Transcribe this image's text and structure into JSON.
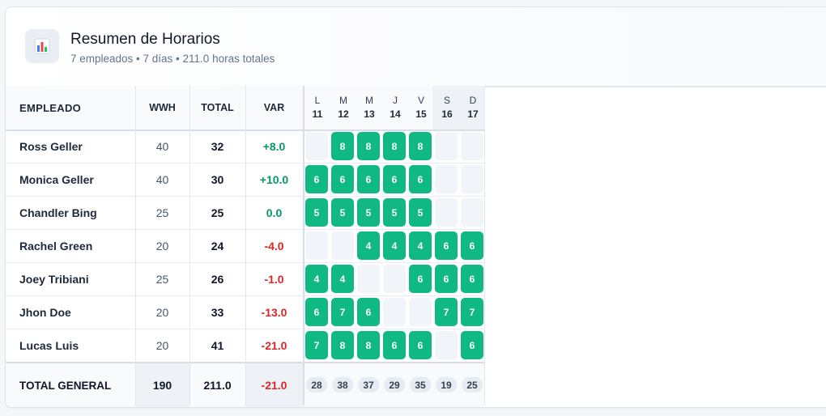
{
  "header": {
    "title": "Resumen de Horarios",
    "subtitle": "7 empleados • 7 días • 211.0 horas totales",
    "icon": "bar-chart-icon"
  },
  "columns": {
    "employee": "EMPLEADO",
    "wwh": "WWH",
    "total": "TOTAL",
    "var": "VAR"
  },
  "days": [
    {
      "letter": "L",
      "num": "11",
      "weekend": false
    },
    {
      "letter": "M",
      "num": "12",
      "weekend": false
    },
    {
      "letter": "M",
      "num": "13",
      "weekend": false
    },
    {
      "letter": "J",
      "num": "14",
      "weekend": false
    },
    {
      "letter": "V",
      "num": "15",
      "weekend": false
    },
    {
      "letter": "S",
      "num": "16",
      "weekend": true
    },
    {
      "letter": "D",
      "num": "17",
      "weekend": true
    }
  ],
  "employees": [
    {
      "name": "Ross Geller",
      "wwh": "40",
      "total": "32",
      "var": "+8.0",
      "var_sign": "pos",
      "hours": [
        "",
        "8",
        "8",
        "8",
        "8",
        "",
        ""
      ]
    },
    {
      "name": "Monica Geller",
      "wwh": "40",
      "total": "30",
      "var": "+10.0",
      "var_sign": "pos",
      "hours": [
        "6",
        "6",
        "6",
        "6",
        "6",
        "",
        ""
      ]
    },
    {
      "name": "Chandler Bing",
      "wwh": "25",
      "total": "25",
      "var": "0.0",
      "var_sign": "zero",
      "hours": [
        "5",
        "5",
        "5",
        "5",
        "5",
        "",
        ""
      ]
    },
    {
      "name": "Rachel Green",
      "wwh": "20",
      "total": "24",
      "var": "-4.0",
      "var_sign": "neg",
      "hours": [
        "",
        "",
        "4",
        "4",
        "4",
        "6",
        "6"
      ]
    },
    {
      "name": "Joey Tribiani",
      "wwh": "25",
      "total": "26",
      "var": "-1.0",
      "var_sign": "neg",
      "hours": [
        "4",
        "4",
        "",
        "",
        "6",
        "6",
        "6"
      ]
    },
    {
      "name": "Jhon Doe",
      "wwh": "20",
      "total": "33",
      "var": "-13.0",
      "var_sign": "neg",
      "hours": [
        "6",
        "7",
        "6",
        "",
        "",
        "7",
        "7"
      ]
    },
    {
      "name": "Lucas Luis",
      "wwh": "20",
      "total": "41",
      "var": "-21.0",
      "var_sign": "neg",
      "hours": [
        "7",
        "8",
        "8",
        "6",
        "6",
        "",
        "6"
      ]
    }
  ],
  "footer": {
    "label": "TOTAL GENERAL",
    "wwh": "190",
    "total": "211.0",
    "var": "-21.0",
    "day_totals": [
      "28",
      "38",
      "37",
      "29",
      "35",
      "19",
      "25"
    ]
  },
  "colors": {
    "shift": "#10b981",
    "positive": "#059669",
    "negative": "#dc2626"
  }
}
